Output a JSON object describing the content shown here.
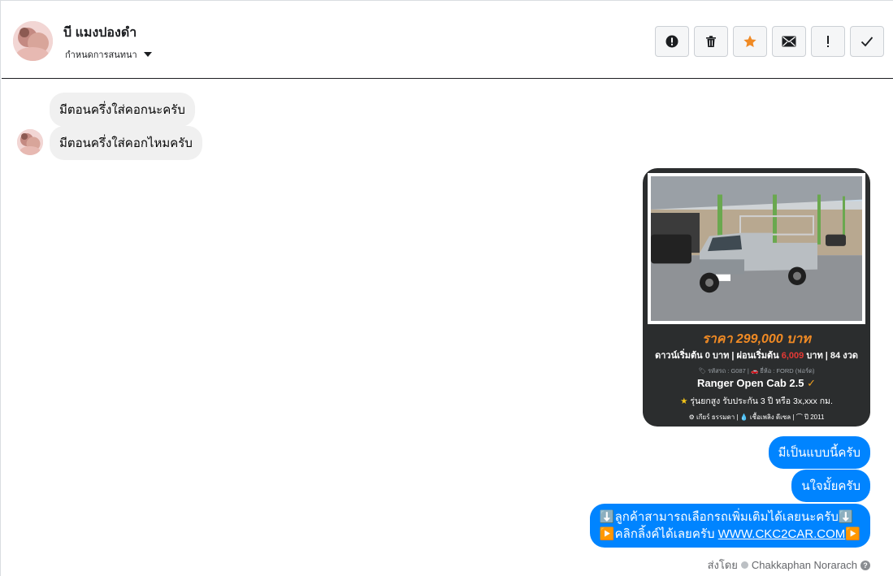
{
  "header": {
    "contact_name": "บี แมงปองดำ",
    "assign_label": "กำหนดการสนทนา",
    "actions": [
      {
        "icon": "alert-circle-icon"
      },
      {
        "icon": "trash-icon"
      },
      {
        "icon": "star-icon",
        "color": "#f08a24"
      },
      {
        "icon": "envelope-icon"
      },
      {
        "icon": "exclamation-icon"
      },
      {
        "icon": "checkmark-icon"
      }
    ]
  },
  "messages": {
    "incoming": [
      "มีตอนครึ่งใส่คอกนะครับ",
      "มีตอนครึ่งใส่คอกไหมครับ"
    ],
    "card": {
      "price": "ราคา 299,000 บาท",
      "down_prefix": "ดาวน์เริ่มต้น 0 บาท | ผ่อนเริ่มต้น ",
      "installment": "6,009",
      "down_suffix": " บาท | 84 งวด",
      "meta": "🏷 รหัสรถ : G087 | 🚗 ยี่ห้อ : FORD (ฟอร์ด)",
      "model": "Ranger Open Cab 2.5",
      "promo": "รุ่นยกสูง รับประกัน 3 ปี หรือ 3x,xxx กม.",
      "specs": "⚙ เกียร์ ธรรมดา   |   💧 เชื้อเพลิง ดีเซล   |   ⌒ ปี 2011"
    },
    "outgoing": [
      "มีเป็นแบบนี้ครับ",
      "นใจมั้ยครับ"
    ],
    "promo_message": {
      "line1": "⬇️ลูกค้าสามารถเลือกรถเพิ่มเติมได้เลยนะครับ⬇️",
      "line2_prefix": "▶️คลิกลิ้งค์ได้เลยครับ ",
      "link": "WWW.CKC2CAR.COM",
      "line2_suffix": "▶️"
    },
    "sent_by_label": "ส่งโดย",
    "sender": "Chakkaphan Norarach"
  },
  "colors": {
    "outgoing_bubble": "#0084ff",
    "incoming_bubble": "#f0f0f0",
    "card_bg": "#2b2d2e",
    "price": "#f08a24",
    "installment": "#e53935"
  }
}
